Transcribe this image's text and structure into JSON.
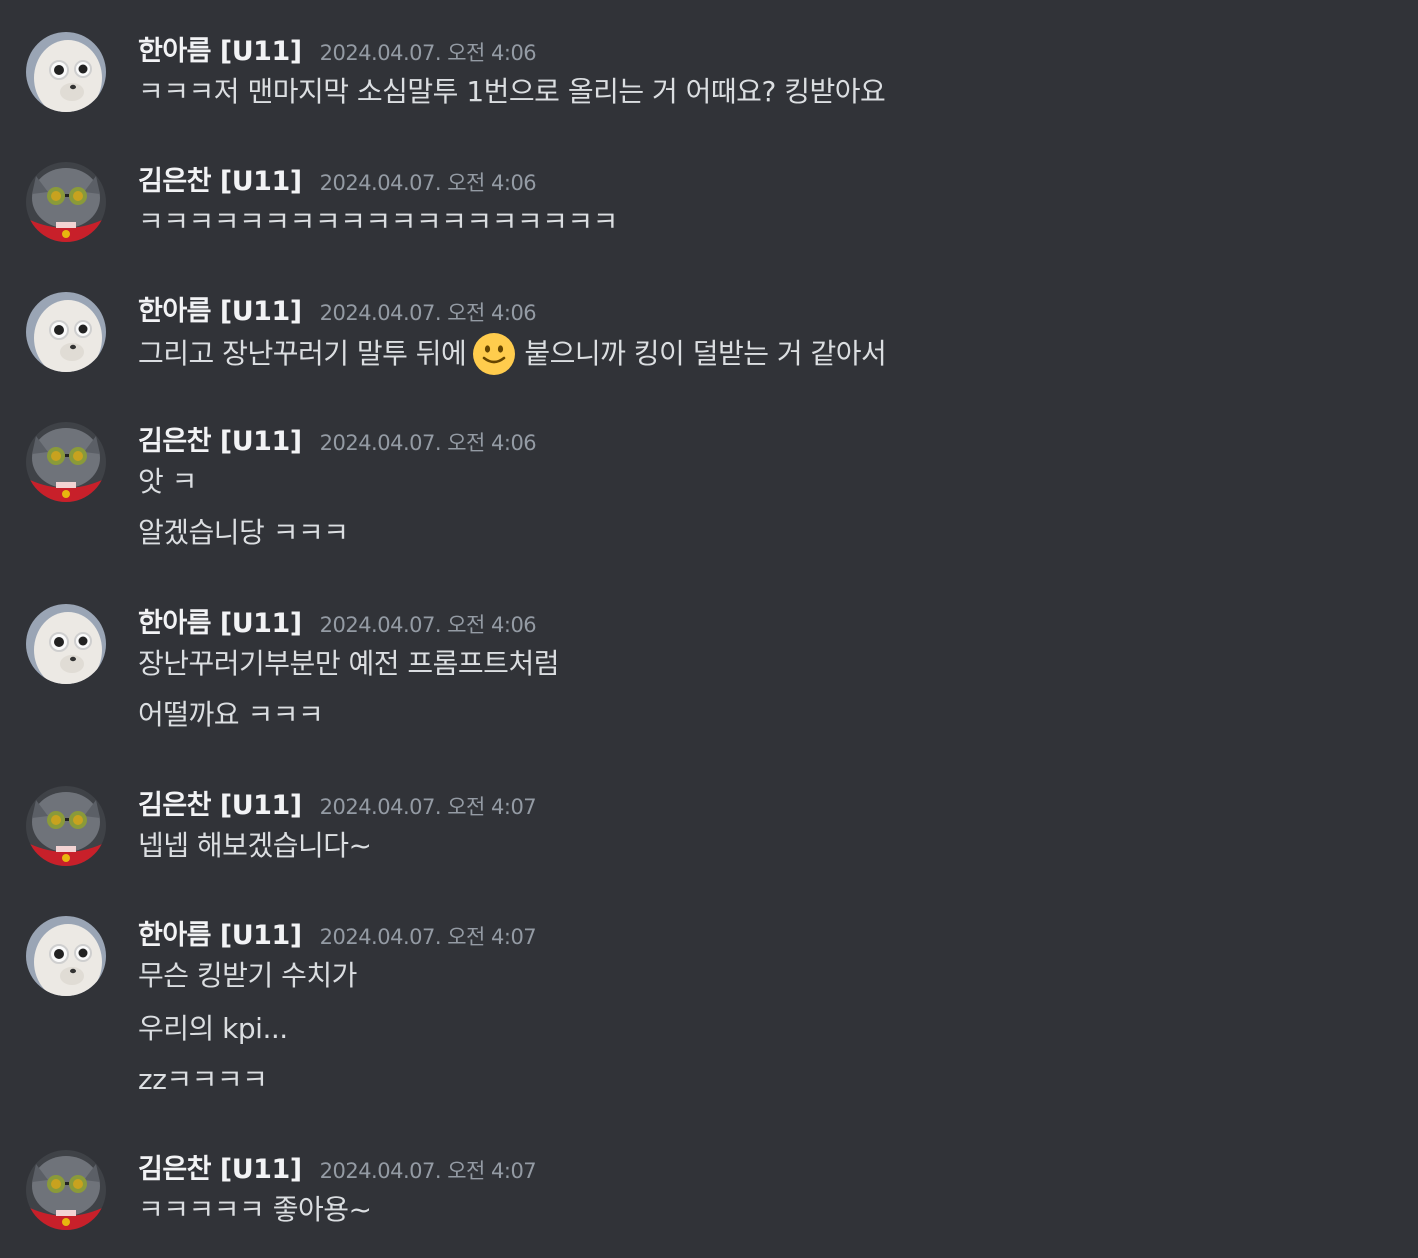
{
  "users": {
    "hanareum": {
      "name": "한아름 [U11]",
      "avatar_icon": "white-dog-sunglasses-avatar-icon"
    },
    "kimeunchan": {
      "name": "김은찬 [U11]",
      "avatar_icon": "gray-cat-sunglasses-avatar-icon"
    }
  },
  "messages": [
    {
      "author": "한아름 [U11]",
      "time": "2024.04.07. 오전 4:06",
      "lines": [
        "ㅋㅋㅋ저 맨마지막 소심말투 1번으로 올리는 거 어때요? 킹받아요"
      ]
    },
    {
      "author": "김은찬 [U11]",
      "time": "2024.04.07. 오전 4:06",
      "lines": [
        "ㅋㅋㅋㅋㅋㅋㅋㅋㅋㅋㅋㅋㅋㅋㅋㅋㅋㅋㅋ"
      ]
    },
    {
      "author": "한아름 [U11]",
      "time": "2024.04.07. 오전 4:06",
      "line_before_emoji": "그리고 장난꾸러기 말투 뒤에",
      "emoji": "slightly-smiling-face-icon",
      "line_after_emoji": "붙으니까 킹이 덜받는 거 같아서"
    },
    {
      "author": "김은찬 [U11]",
      "time": "2024.04.07. 오전 4:06",
      "lines": [
        "앗 ㅋ",
        "알겠습니당 ㅋㅋㅋ"
      ]
    },
    {
      "author": "한아름 [U11]",
      "time": "2024.04.07. 오전 4:06",
      "lines": [
        "장난꾸러기부분만 예전 프롬프트처럼",
        "어떨까요 ㅋㅋㅋ"
      ]
    },
    {
      "author": "김은찬 [U11]",
      "time": "2024.04.07. 오전 4:07",
      "lines": [
        "넵넵 해보겠습니다~"
      ]
    },
    {
      "author": "한아름 [U11]",
      "time": "2024.04.07. 오전 4:07",
      "lines": [
        "무슨 킹받기 수치가",
        "우리의 kpi...",
        "zzㅋㅋㅋㅋ"
      ]
    },
    {
      "author": "김은찬 [U11]",
      "time": "2024.04.07. 오전 4:07",
      "lines": [
        "ㅋㅋㅋㅋㅋ 좋아용~"
      ]
    }
  ],
  "colors": {
    "background": "#313338",
    "author": "#f2f3f5",
    "timestamp": "#949ba4",
    "text": "#dbdee1"
  }
}
